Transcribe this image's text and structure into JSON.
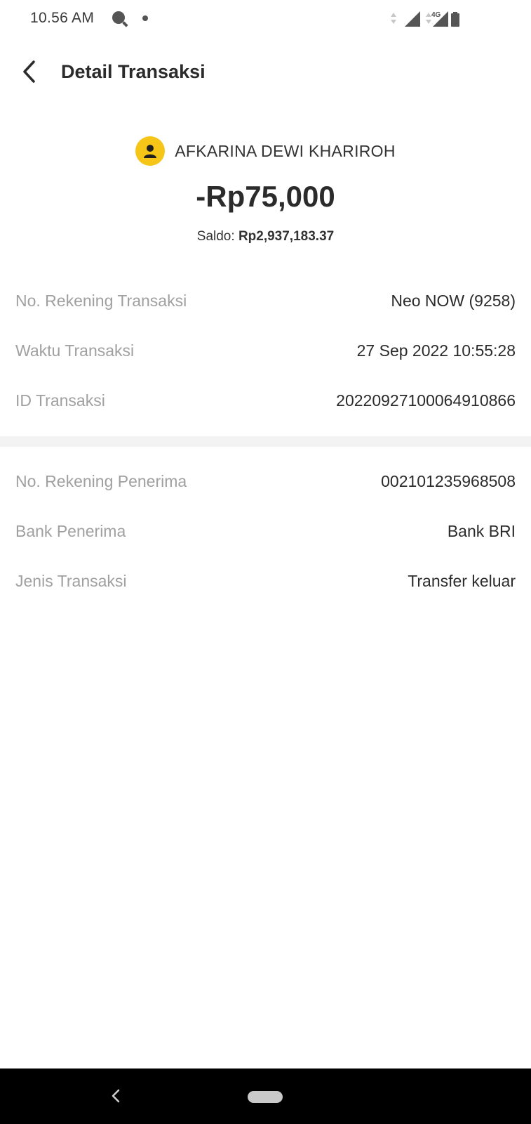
{
  "status_bar": {
    "time": "10.56 AM",
    "network_label": "4G",
    "icons": [
      "search-icon",
      "notification-dot-icon",
      "data-arrows-icon",
      "signal-icon",
      "signal-4g-icon",
      "battery-icon"
    ]
  },
  "header": {
    "title": "Detail Transaksi",
    "back_icon": "chevron-left-icon"
  },
  "summary": {
    "recipient_name": "AFKARINA DEWI KHARIROH",
    "avatar_icon": "person-icon",
    "avatar_color": "#f5c518",
    "amount": "-Rp75,000",
    "balance_label": "Saldo: ",
    "balance_value": "Rp2,937,183.37"
  },
  "transaction_details": [
    {
      "label": "No. Rekening Transaksi",
      "value": "Neo NOW (9258)"
    },
    {
      "label": "Waktu Transaksi",
      "value": "27 Sep 2022 10:55:28"
    },
    {
      "label": "ID Transaksi",
      "value": "20220927100064910866"
    }
  ],
  "recipient_details": [
    {
      "label": "No. Rekening Penerima",
      "value": "002101235968508"
    },
    {
      "label": "Bank Penerima",
      "value": "Bank BRI"
    },
    {
      "label": "Jenis Transaksi",
      "value": "Transfer keluar"
    }
  ],
  "nav_bar": {
    "back_icon": "nav-back-icon",
    "home_icon": "home-pill-icon"
  }
}
